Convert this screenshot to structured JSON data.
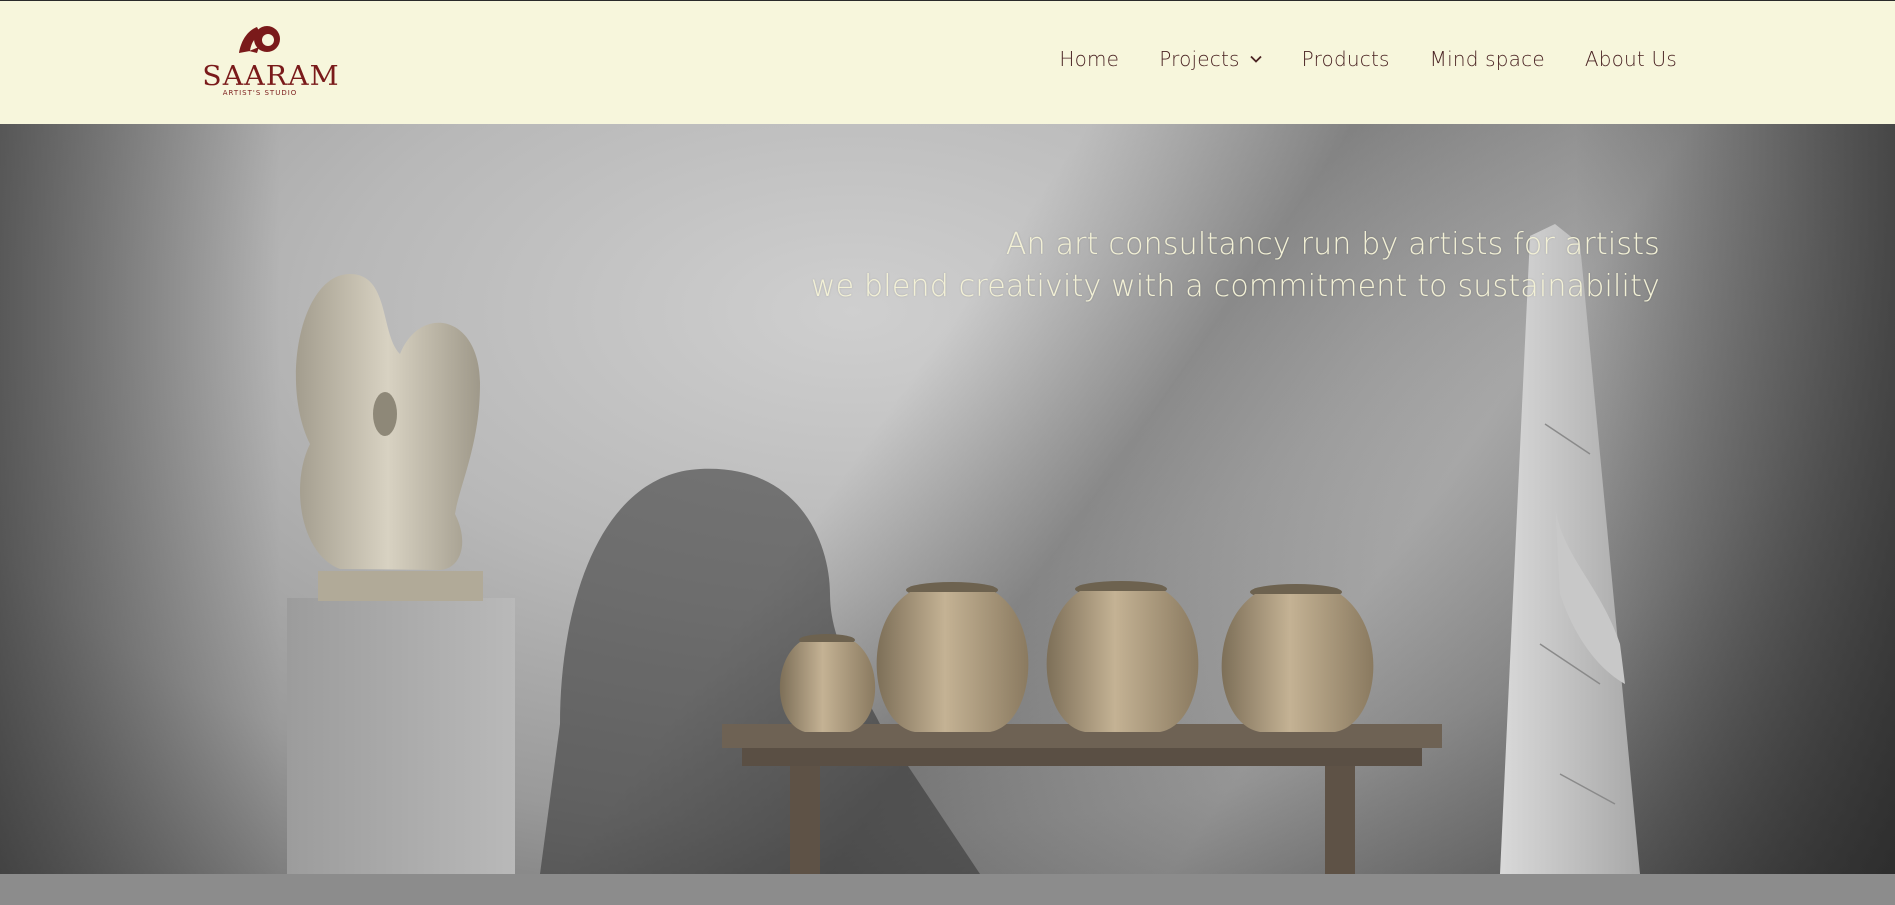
{
  "brand": {
    "name": "SAARAM",
    "subtitle": "ARTIST'S STUDIO",
    "color": "#7a1a1a"
  },
  "nav": {
    "items": [
      {
        "label": "Home"
      },
      {
        "label": "Projects",
        "has_dropdown": true
      },
      {
        "label": "Products"
      },
      {
        "label": "Mind space"
      },
      {
        "label": "About Us"
      }
    ]
  },
  "hero": {
    "line1": "An art consultancy run by artists for artists",
    "line2": "we blend creativity with a commitment to sustainability"
  },
  "colors": {
    "header_bg": "#f7f6dc",
    "nav_text": "#4a2323",
    "tagline_text": "#f3f1d6"
  }
}
